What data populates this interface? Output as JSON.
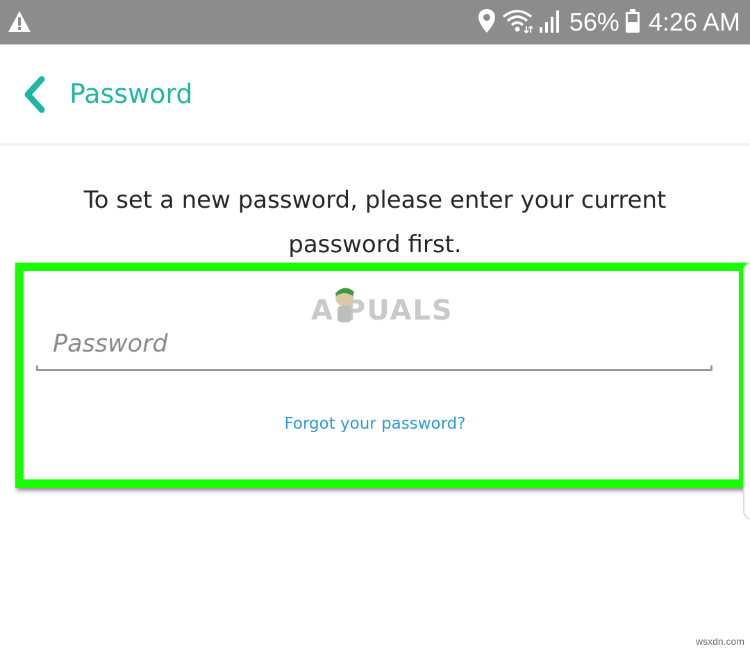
{
  "status_bar": {
    "battery_percent": "56%",
    "time": "4:26 AM",
    "icons": [
      "warning-icon",
      "location-icon",
      "wifi-icon",
      "signal-icon",
      "battery-icon"
    ]
  },
  "header": {
    "title": "Password",
    "back_icon": "chevron-left-icon"
  },
  "instruction": "To set a new password, please enter your current password first.",
  "password_field": {
    "value": "",
    "placeholder": "Password"
  },
  "forgot_link": "Forgot your password?",
  "watermark": {
    "brand": "A  PUALS"
  },
  "site_watermark": "wsxdn.com",
  "colors": {
    "accent": "#1eb7a4",
    "link": "#2b9ad2",
    "highlight": "#15ff00",
    "status_bar": "#8c8c8c"
  }
}
